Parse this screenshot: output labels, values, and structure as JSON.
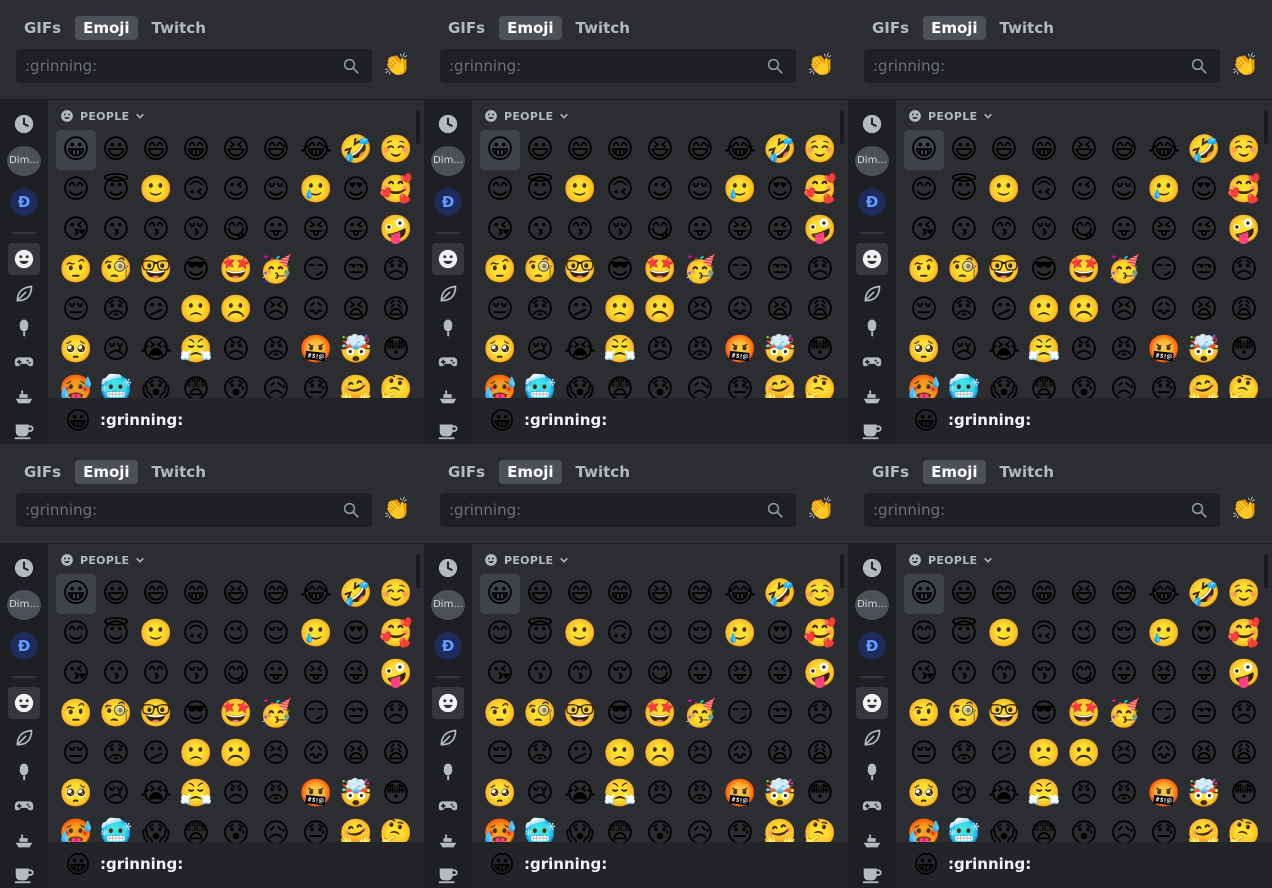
{
  "tabs": [
    "GIFs",
    "Emoji",
    "Twitch"
  ],
  "active_tab": "Emoji",
  "search": {
    "placeholder": ":grinning:"
  },
  "skin_tone_emoji": "👏",
  "sidebar": {
    "dim_label": "Dim...",
    "server_letter": "Ɖ"
  },
  "category": {
    "title": "PEOPLE"
  },
  "emoji_rows": [
    [
      "😀",
      "😃",
      "😄",
      "😁",
      "😆",
      "😅",
      "😂",
      "🤣",
      "☺️"
    ],
    [
      "😊",
      "😇",
      "🙂",
      "🙃",
      "😉",
      "😌",
      "🥲",
      "😍",
      "🥰"
    ],
    [
      "😘",
      "😗",
      "😙",
      "😚",
      "😋",
      "😛",
      "😝",
      "😜",
      "🤪"
    ],
    [
      "🤨",
      "🧐",
      "🤓",
      "😎",
      "🤩",
      "🥳",
      "😏",
      "😒",
      "😞"
    ],
    [
      "😔",
      "😟",
      "😕",
      "🙁",
      "☹️",
      "😣",
      "😖",
      "😫",
      "😩"
    ],
    [
      "🥺",
      "😢",
      "😭",
      "😤",
      "😠",
      "😡",
      "🤬",
      "🤯",
      "😳"
    ],
    [
      "🥵",
      "🥶",
      "😱",
      "😨",
      "😰",
      "😥",
      "😓",
      "🤗",
      "🤔"
    ]
  ],
  "footer": {
    "emoji": "😀",
    "name": ":grinning:"
  },
  "panel_count": 6,
  "colors": {
    "background": "#2b2d31",
    "sidebar": "#1e1f22",
    "active_tab": "#4e5058",
    "accent": "#5865f2"
  }
}
